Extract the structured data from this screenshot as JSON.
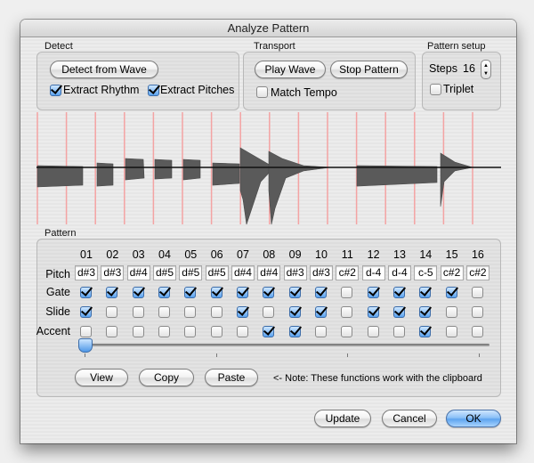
{
  "window": {
    "title": "Analyze Pattern"
  },
  "detect": {
    "label": "Detect",
    "detect_button": "Detect from Wave",
    "extract_rhythm": {
      "label": "Extract Rhythm",
      "checked": true
    },
    "extract_pitches": {
      "label": "Extract Pitches",
      "checked": true
    }
  },
  "transport": {
    "label": "Transport",
    "play_button": "Play Wave",
    "stop_button": "Stop Pattern",
    "match_tempo": {
      "label": "Match Tempo",
      "checked": false
    }
  },
  "pattern_setup": {
    "label": "Pattern setup",
    "steps_label": "Steps",
    "steps_value": "16",
    "triplet": {
      "label": "Triplet",
      "checked": false
    }
  },
  "waveform": {
    "marker_color": "#f4a3a3",
    "step_markers": 16
  },
  "pattern": {
    "label": "Pattern",
    "row_labels": {
      "pitch": "Pitch",
      "gate": "Gate",
      "slide": "Slide",
      "accent": "Accent"
    },
    "steps": [
      {
        "num": "01",
        "pitch": "d#3",
        "gate": true,
        "slide": true,
        "accent": false
      },
      {
        "num": "02",
        "pitch": "d#3",
        "gate": true,
        "slide": false,
        "accent": false
      },
      {
        "num": "03",
        "pitch": "d#4",
        "gate": true,
        "slide": false,
        "accent": false
      },
      {
        "num": "04",
        "pitch": "d#5",
        "gate": true,
        "slide": false,
        "accent": false
      },
      {
        "num": "05",
        "pitch": "d#5",
        "gate": true,
        "slide": false,
        "accent": false
      },
      {
        "num": "06",
        "pitch": "d#5",
        "gate": true,
        "slide": false,
        "accent": false
      },
      {
        "num": "07",
        "pitch": "d#4",
        "gate": true,
        "slide": true,
        "accent": false
      },
      {
        "num": "08",
        "pitch": "d#4",
        "gate": true,
        "slide": false,
        "accent": true
      },
      {
        "num": "09",
        "pitch": "d#3",
        "gate": true,
        "slide": true,
        "accent": true
      },
      {
        "num": "10",
        "pitch": "d#3",
        "gate": true,
        "slide": true,
        "accent": false
      },
      {
        "num": "11",
        "pitch": "c#2",
        "gate": false,
        "slide": false,
        "accent": false
      },
      {
        "num": "12",
        "pitch": "d-4",
        "gate": true,
        "slide": true,
        "accent": false
      },
      {
        "num": "13",
        "pitch": "d-4",
        "gate": true,
        "slide": true,
        "accent": false
      },
      {
        "num": "14",
        "pitch": "c-5",
        "gate": true,
        "slide": true,
        "accent": true
      },
      {
        "num": "15",
        "pitch": "c#2",
        "gate": true,
        "slide": false,
        "accent": false
      },
      {
        "num": "16",
        "pitch": "c#2",
        "gate": false,
        "slide": false,
        "accent": false
      }
    ],
    "slider_value": 0,
    "view_button": "View",
    "copy_button": "Copy",
    "paste_button": "Paste",
    "note": "<- Note: These functions work with the clipboard"
  },
  "footer": {
    "update_button": "Update",
    "cancel_button": "Cancel",
    "ok_button": "OK"
  }
}
